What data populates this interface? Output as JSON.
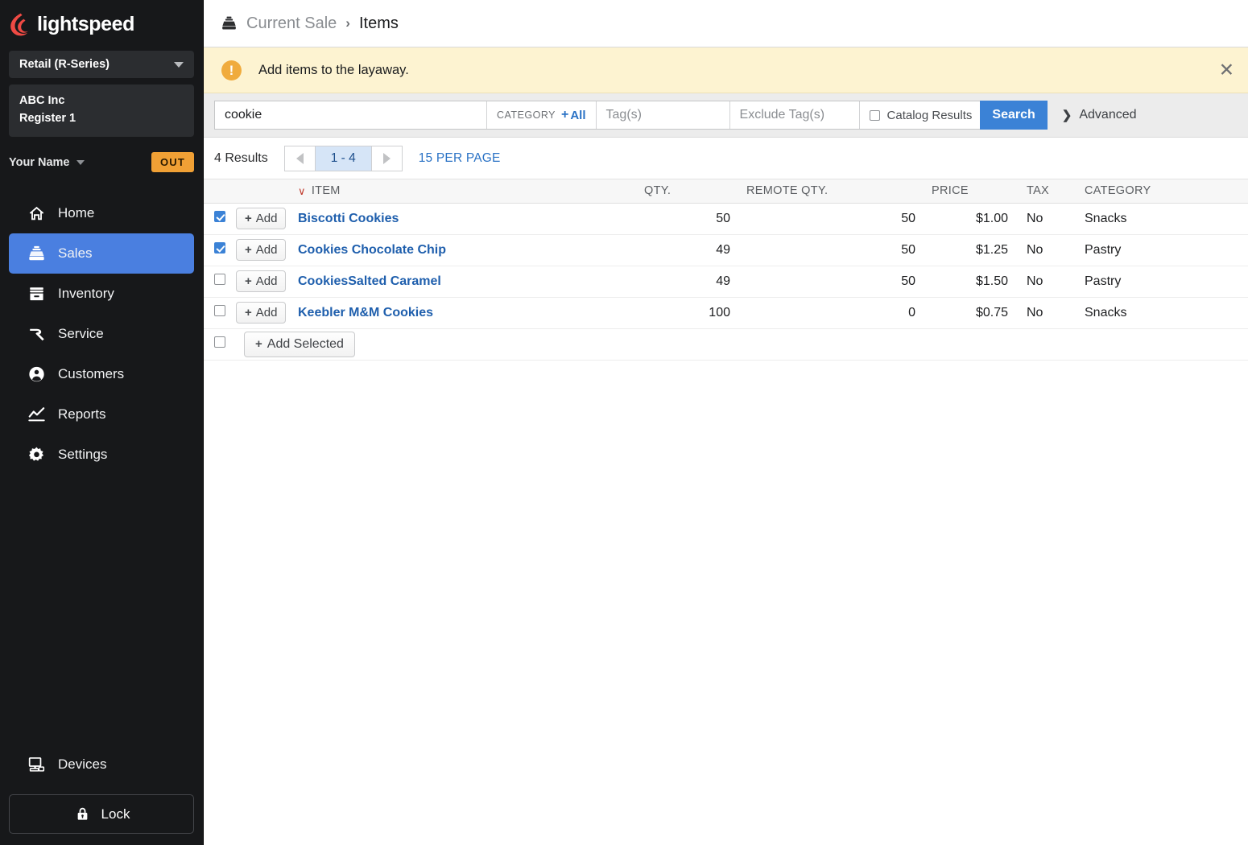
{
  "brand": {
    "name": "lightspeed",
    "flame_color": "#ef4a44"
  },
  "sidebar": {
    "product_picker": {
      "label": "Retail (R-Series)",
      "icon": "chevron-down-icon"
    },
    "store": {
      "company": "ABC Inc",
      "register": "Register 1"
    },
    "user": {
      "name": "Your Name",
      "status_badge": "OUT"
    },
    "nav": [
      {
        "label": "Home",
        "icon": "home-icon",
        "active": false
      },
      {
        "label": "Sales",
        "icon": "register-icon",
        "active": true
      },
      {
        "label": "Inventory",
        "icon": "box-icon",
        "active": false
      },
      {
        "label": "Service",
        "icon": "hammer-icon",
        "active": false
      },
      {
        "label": "Customers",
        "icon": "person-icon",
        "active": false
      },
      {
        "label": "Reports",
        "icon": "chart-line-icon",
        "active": false
      },
      {
        "label": "Settings",
        "icon": "gear-icon",
        "active": false
      }
    ],
    "devices": {
      "label": "Devices",
      "icon": "monitor-icon"
    },
    "lock": {
      "label": "Lock",
      "icon": "lock-icon"
    }
  },
  "breadcrumb": {
    "icon": "register-icon",
    "parent": "Current Sale",
    "separator": "›",
    "current": "Items"
  },
  "notice": {
    "icon": "warning-icon",
    "message": "Add items to the layaway.",
    "close_icon": "close-icon",
    "bg": "#fdf3d1",
    "icon_color": "#f0ab3d"
  },
  "search": {
    "query_value": "cookie",
    "query_placeholder": "",
    "category_label": "CATEGORY",
    "category_all": "All",
    "category_plus": "+",
    "tags_placeholder": "Tag(s)",
    "exclude_tags_placeholder": "Exclude Tag(s)",
    "catalog_results_label": "Catalog Results",
    "catalog_results_checked": false,
    "search_button": "Search",
    "advanced_label": "Advanced",
    "advanced_chevron": "❯",
    "accent": "#3b82d6"
  },
  "pager": {
    "results_count": "4 Results",
    "prev_icon": "triangle-left-icon",
    "range": "1 - 4",
    "next_icon": "triangle-right-icon",
    "per_page": "15 PER PAGE"
  },
  "table": {
    "sort_indicator": "∨",
    "columns": [
      "ITEM",
      "QTY.",
      "REMOTE QTY.",
      "PRICE",
      "TAX",
      "CATEGORY"
    ],
    "add_label": "Add",
    "add_icon": "plus-icon",
    "rows": [
      {
        "checked": true,
        "name": "Biscotti Cookies",
        "qty": "50",
        "remote_qty": "50",
        "price": "$1.00",
        "tax": "No",
        "category": "Snacks"
      },
      {
        "checked": true,
        "name": "Cookies Chocolate Chip",
        "qty": "49",
        "remote_qty": "50",
        "price": "$1.25",
        "tax": "No",
        "category": "Pastry"
      },
      {
        "checked": false,
        "name": "CookiesSalted Caramel",
        "qty": "49",
        "remote_qty": "50",
        "price": "$1.50",
        "tax": "No",
        "category": "Pastry"
      },
      {
        "checked": false,
        "name": "Keebler M&M Cookies",
        "qty": "100",
        "remote_qty": "0",
        "price": "$0.75",
        "tax": "No",
        "category": "Snacks"
      }
    ],
    "add_selected": {
      "label": "Add Selected",
      "icon": "plus-icon",
      "checked": false
    }
  }
}
